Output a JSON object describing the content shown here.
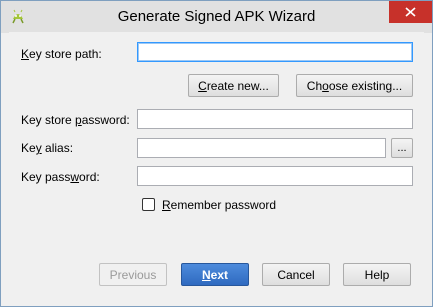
{
  "window": {
    "title": "Generate Signed APK Wizard"
  },
  "form": {
    "key_store_path": {
      "label_u": "K",
      "label_rest": "ey store path:",
      "value": ""
    },
    "create_new_label_u": "C",
    "create_new_label_rest": "reate new...",
    "choose_existing_label_pre": "Ch",
    "choose_existing_label_u": "o",
    "choose_existing_label_rest": "ose existing...",
    "key_store_password": {
      "label_pre": "Key store ",
      "label_u": "p",
      "label_rest": "assword:",
      "value": ""
    },
    "key_alias": {
      "label_pre": "Ke",
      "label_u": "y",
      "label_rest": " alias:",
      "value": ""
    },
    "browse_label": "...",
    "key_password": {
      "label_pre": "Key pass",
      "label_u": "w",
      "label_rest": "ord:",
      "value": ""
    },
    "remember_password": {
      "label_u": "R",
      "label_rest": "emember password",
      "checked": false
    }
  },
  "footer": {
    "previous_label": "Previous",
    "next_label_u": "N",
    "next_label_rest": "ext",
    "cancel_label": "Cancel",
    "help_label": "Help"
  },
  "colors": {
    "close_button": "#c7312a",
    "primary_button": "#2f6ac0",
    "android_green": "#a4c639"
  }
}
